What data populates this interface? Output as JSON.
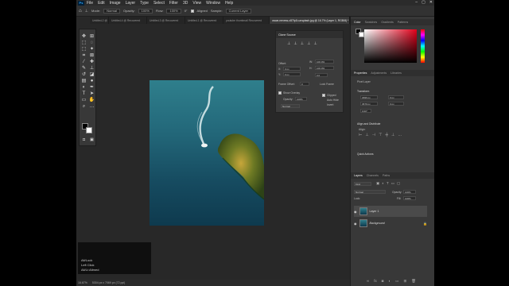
{
  "menu": {
    "logo": "Ps",
    "items": [
      "File",
      "Edit",
      "Image",
      "Layer",
      "Type",
      "Select",
      "Filter",
      "3D",
      "View",
      "Window",
      "Help"
    ]
  },
  "window_controls": [
    "–",
    "▢",
    "✕"
  ],
  "options": {
    "mode_label": "Mode:",
    "mode_value": "Normal",
    "opacity_label": "Opacity:",
    "opacity_value": "100%",
    "flow_label": "Flow:",
    "flow_value": "100%",
    "aligned_label": "Aligned",
    "sample_label": "Sample:",
    "sample_value": "Current Layer",
    "angle_value": "0°"
  },
  "tabs": [
    {
      "label": "Untitled-2 @ ..."
    },
    {
      "label": "Untitled-4 @ Recovered"
    },
    {
      "label": "Untitled-3 @ Recovered"
    },
    {
      "label": "Untitled-1 @ Recovered"
    },
    {
      "label": "youtube thumbnail Recovered"
    },
    {
      "label": "oscar-nevess-c87fp1t-unsplash.jpg @ 16.7% (Layer 1, RGB/8) *"
    }
  ],
  "clone_source": {
    "title": "Clone Source",
    "offset_label": "Offset:",
    "x_label": "X:",
    "x_value": "0 px",
    "y_label": "Y:",
    "y_value": "0 px",
    "w_label": "W:",
    "w_value": "100.0%",
    "h_label": "H:",
    "h_value": "100.0%",
    "angle_value": "0.0",
    "frame_offset_label": "Frame Offset:",
    "frame_offset_value": "0",
    "lock_frame_label": "Lock Frame",
    "show_overlay_label": "Show Overlay",
    "clipped_label": "Clipped",
    "opacity_label": "Opacity:",
    "opacity_value": "100%",
    "auto_hide_label": "Auto Hide",
    "invert_label": "Invert",
    "blend_value": "Normal"
  },
  "hud": {
    "line1": "Alt/Lock",
    "line2": "Left Click",
    "line3": "Alt/Lt Altmed"
  },
  "status": {
    "zoom": "16.67%",
    "doc": "5304 px x 7069 px (72 ppi)"
  },
  "color_panel": {
    "tabs": [
      "Color",
      "Swatches",
      "Gradients",
      "Patterns"
    ]
  },
  "properties": {
    "tabs": [
      "Properties",
      "Adjustments",
      "Libraries"
    ],
    "kind": "Pixel Layer",
    "transform_label": "Transform",
    "w_value": "2996 px",
    "h_value": "3679 px",
    "x_value": "0 px",
    "y_value": "0 px",
    "angle_value": "0.00°",
    "align_label": "Align and Distribute",
    "align_sub": "Align:",
    "quick_label": "Quick Actions"
  },
  "layers": {
    "tabs": [
      "Layers",
      "Channels",
      "Paths"
    ],
    "kind_value": "Kind",
    "blend_value": "Normal",
    "opacity_label": "Opacity:",
    "opacity_value": "100%",
    "lock_label": "Lock:",
    "fill_label": "Fill:",
    "fill_value": "100%",
    "items": [
      {
        "name": "Layer 1"
      },
      {
        "name": "Background"
      }
    ]
  },
  "colors": {
    "fg": "#000000",
    "bg": "#ffffff",
    "accent": "#31a8ff"
  }
}
